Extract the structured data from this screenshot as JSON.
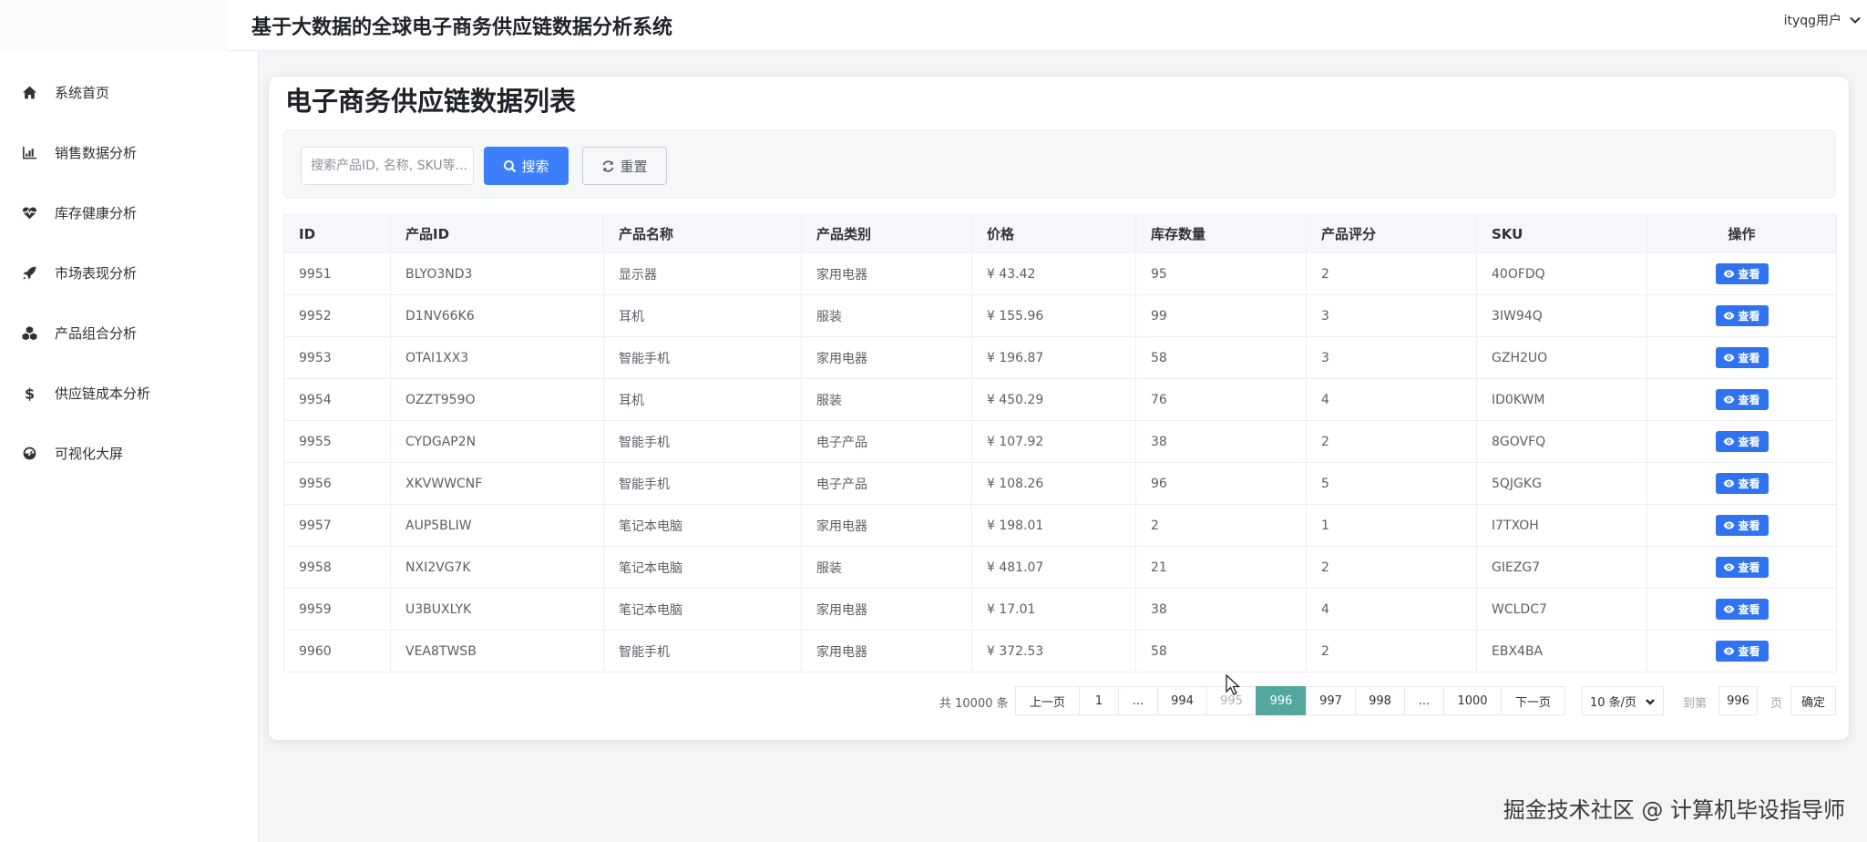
{
  "header": {
    "title": "基于大数据的全球电子商务供应链数据分析系统",
    "user": "ityqg用户"
  },
  "sidebar": {
    "items": [
      {
        "label": "系统首页",
        "icon": "home-icon"
      },
      {
        "label": "销售数据分析",
        "icon": "bar-chart-icon"
      },
      {
        "label": "库存健康分析",
        "icon": "heartbeat-icon"
      },
      {
        "label": "市场表现分析",
        "icon": "rocket-icon"
      },
      {
        "label": "产品组合分析",
        "icon": "cubes-icon"
      },
      {
        "label": "供应链成本分析",
        "icon": "dollar-icon"
      },
      {
        "label": "可视化大屏",
        "icon": "dashboard-icon"
      }
    ]
  },
  "main": {
    "title": "电子商务供应链数据列表",
    "search": {
      "placeholder": "搜索产品ID, 名称, SKU等...",
      "value": "",
      "search_label": "搜索",
      "reset_label": "重置"
    },
    "table": {
      "columns": [
        "ID",
        "产品ID",
        "产品名称",
        "产品类别",
        "价格",
        "库存数量",
        "产品评分",
        "SKU",
        "操作"
      ],
      "action_label": "查看",
      "rows": [
        [
          "9951",
          "BLYO3ND3",
          "显示器",
          "家用电器",
          "¥ 43.42",
          "95",
          "2",
          "40OFDQ"
        ],
        [
          "9952",
          "D1NV66K6",
          "耳机",
          "服装",
          "¥ 155.96",
          "99",
          "3",
          "3IW94Q"
        ],
        [
          "9953",
          "OTAI1XX3",
          "智能手机",
          "家用电器",
          "¥ 196.87",
          "58",
          "3",
          "GZH2UO"
        ],
        [
          "9954",
          "OZZT959O",
          "耳机",
          "服装",
          "¥ 450.29",
          "76",
          "4",
          "ID0KWM"
        ],
        [
          "9955",
          "CYDGAP2N",
          "智能手机",
          "电子产品",
          "¥ 107.92",
          "38",
          "2",
          "8GOVFQ"
        ],
        [
          "9956",
          "XKVWWCNF",
          "智能手机",
          "电子产品",
          "¥ 108.26",
          "96",
          "5",
          "5QJGKG"
        ],
        [
          "9957",
          "AUP5BLIW",
          "笔记本电脑",
          "家用电器",
          "¥ 198.01",
          "2",
          "1",
          "I7TXOH"
        ],
        [
          "9958",
          "NXI2VG7K",
          "笔记本电脑",
          "服装",
          "¥ 481.07",
          "21",
          "2",
          "GIEZG7"
        ],
        [
          "9959",
          "U3BUXLYK",
          "笔记本电脑",
          "家用电器",
          "¥ 17.01",
          "38",
          "4",
          "WCLDC7"
        ],
        [
          "9960",
          "VEA8TWSB",
          "智能手机",
          "家用电器",
          "¥ 372.53",
          "58",
          "2",
          "EBX4BA"
        ]
      ]
    },
    "pagination": {
      "total_text": "共 10000 条",
      "prev_label": "上一页",
      "next_label": "下一页",
      "pages": [
        "1",
        "...",
        "994",
        "995",
        "996",
        "997",
        "998",
        "...",
        "1000"
      ],
      "current_page": "996",
      "page_size": "10 条/页",
      "goto_label": "到第",
      "goto_value": "996",
      "goto_unit": "页",
      "confirm_label": "确定"
    }
  },
  "watermark": "掘金技术社区 @ 计算机毕设指导师",
  "colors": {
    "primary": "#3d7efb",
    "view_button": "#2f73f0",
    "active_page": "#52a79f"
  }
}
